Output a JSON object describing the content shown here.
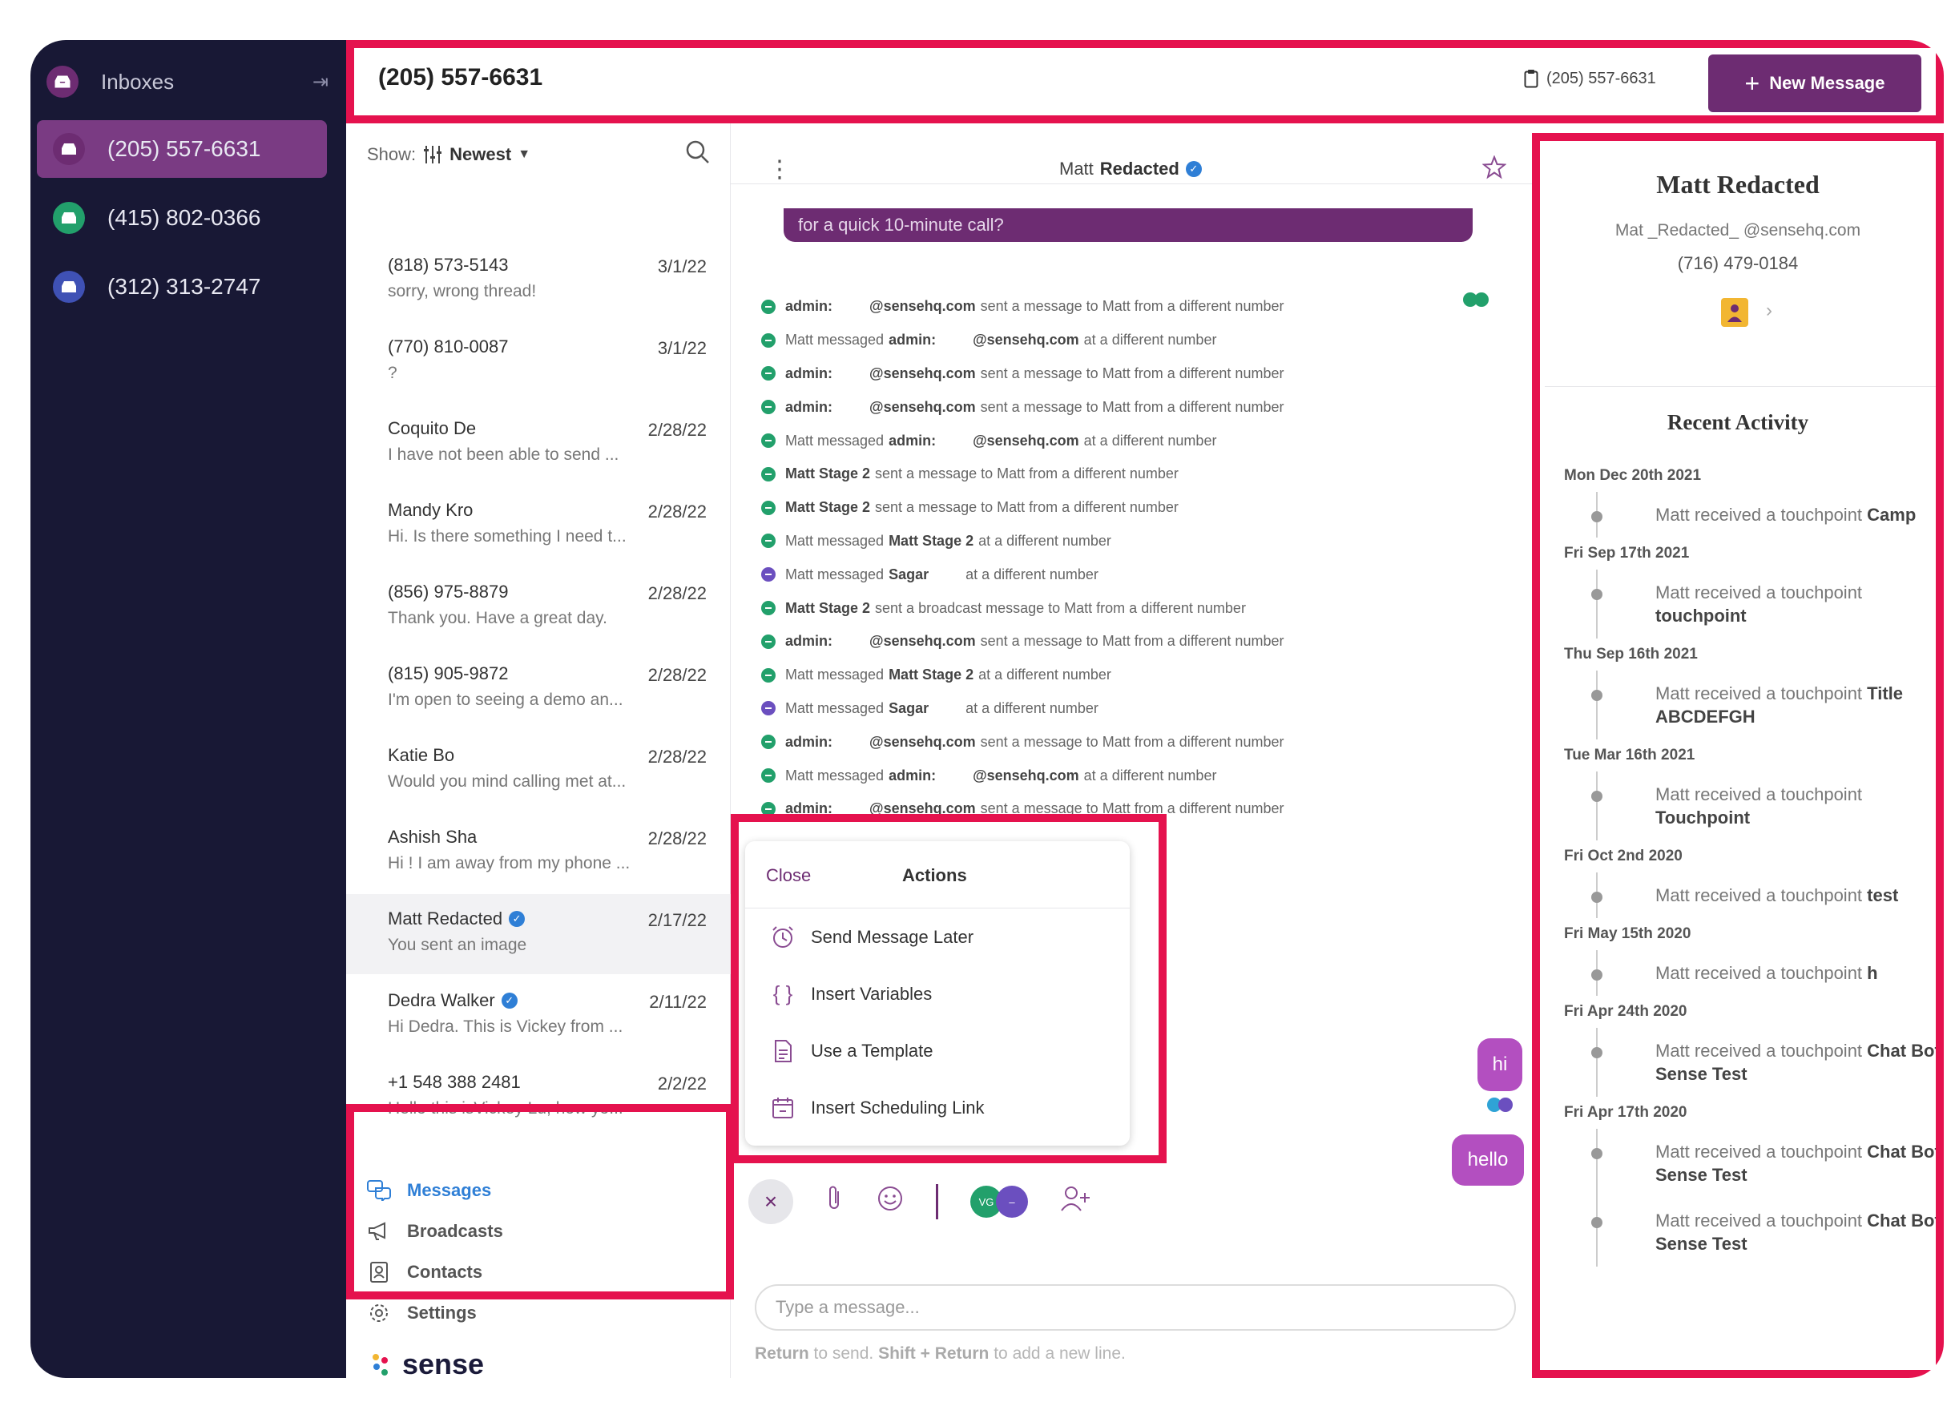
{
  "sidebar": {
    "title": "Inboxes",
    "inboxes": [
      {
        "label": "(205) 557-6631",
        "color": "#6d2c72"
      },
      {
        "label": "(415) 802-0366",
        "color": "#22a06b"
      },
      {
        "label": "(312) 313-2747",
        "color": "#3f51b5"
      }
    ]
  },
  "topbar": {
    "number": "(205) 557-6631",
    "small_number": "(205) 557-6631",
    "new_message": "New Message"
  },
  "list": {
    "show_label": "Show:",
    "sort": "Newest",
    "conversations": [
      {
        "name": "(818) 573-5143",
        "date": "3/1/22",
        "preview": "sorry, wrong thread!"
      },
      {
        "name": "(770) 810-0087",
        "date": "3/1/22",
        "preview": "?"
      },
      {
        "name": "Coquito De",
        "date": "2/28/22",
        "preview": "I have not been able to send ..."
      },
      {
        "name": "Mandy Kro",
        "date": "2/28/22",
        "preview": "Hi. Is there something I need t..."
      },
      {
        "name": "(856) 975-8879",
        "date": "2/28/22",
        "preview": "Thank you. Have a great day."
      },
      {
        "name": "(815) 905-9872",
        "date": "2/28/22",
        "preview": "I'm open to seeing a demo an..."
      },
      {
        "name": "Katie Bo",
        "date": "2/28/22",
        "preview": "Would you mind calling met at..."
      },
      {
        "name": "Ashish Sha",
        "date": "2/28/22",
        "preview": "Hi ! I am away from my phone ..."
      },
      {
        "name": "Matt  Redacted",
        "date": "2/17/22",
        "preview": "You sent an image"
      },
      {
        "name": "Dedra Walker",
        "date": "2/11/22",
        "preview": "Hi Dedra. This is Vickey from ..."
      },
      {
        "name": "+1 548 388 2481",
        "date": "2/2/22",
        "preview": "Hello this isVickey Lu, how yo..."
      }
    ]
  },
  "nav": {
    "messages": "Messages",
    "broadcasts": "Broadcasts",
    "contacts": "Contacts",
    "settings": "Settings"
  },
  "brand": "sense",
  "chat": {
    "first": "Matt",
    "last": "Redacted",
    "top_bubble": "for a quick 10-minute call?",
    "events": [
      {
        "a": "admin:",
        "b": "@sensehq.com",
        "t": "sent a message to Matt from a different number",
        "kind": "green"
      },
      {
        "pre": "Matt messaged",
        "a": "admin:",
        "b": "@sensehq.com",
        "t": "at a different number",
        "kind": "green"
      },
      {
        "a": "admin:",
        "b": "@sensehq.com",
        "t": "sent a message to Matt from a different number",
        "kind": "green"
      },
      {
        "a": "admin:",
        "b": "@sensehq.com",
        "t": "sent a message to Matt from a different number",
        "kind": "green"
      },
      {
        "pre": "Matt messaged",
        "a": "admin:",
        "b": "@sensehq.com",
        "t": "at a different number",
        "kind": "green"
      },
      {
        "a": "Matt Stage 2",
        "t": "sent a message to Matt from a different number",
        "kind": "green"
      },
      {
        "a": "Matt Stage 2",
        "t": "sent a message to Matt from a different number",
        "kind": "green"
      },
      {
        "pre": "Matt messaged",
        "a": "Matt Stage 2",
        "t": "at a different number",
        "kind": "green"
      },
      {
        "pre": "Matt messaged",
        "a": "Sagar",
        "t": "at a different number",
        "kind": "purple"
      },
      {
        "a": "Matt Stage 2",
        "t": "sent a broadcast message to Matt from a different number",
        "kind": "green"
      },
      {
        "a": "admin:",
        "b": "@sensehq.com",
        "t": "sent a message to Matt from a different number",
        "kind": "green"
      },
      {
        "pre": "Matt messaged",
        "a": "Matt Stage 2",
        "t": "at a different number",
        "kind": "green"
      },
      {
        "pre": "Matt messaged",
        "a": "Sagar",
        "t": "at a different number",
        "kind": "purple"
      },
      {
        "a": "admin:",
        "b": "@sensehq.com",
        "t": "sent a message to Matt from a different number",
        "kind": "green"
      },
      {
        "pre": "Matt messaged",
        "a": "admin:",
        "b": "@sensehq.com",
        "t": "at a different number",
        "kind": "green"
      },
      {
        "a": "admin:",
        "b": "@sensehq.com",
        "t": "sent a message to Matt from a different number",
        "kind": "green"
      }
    ],
    "msg_hi": "hi",
    "msg_hello": "hello",
    "actions": {
      "close": "Close",
      "title": "Actions",
      "items": [
        "Send Message Later",
        "Insert Variables",
        "Use a Template",
        "Insert Scheduling Link"
      ]
    },
    "avatar_initials": "VG",
    "input_placeholder": "Type a message...",
    "hint": {
      "k1": "Return",
      "t1": "to send.",
      "k2": "Shift",
      "plus": "+",
      "k3": "Return",
      "t2": "to add a new line."
    }
  },
  "profile": {
    "name": "Matt  Redacted",
    "email": "Mat _Redacted_ @sensehq.com",
    "phone": "(716) 479-0184",
    "recent_title": "Recent Activity",
    "activity": [
      {
        "date": "Mon Dec 20th 2021",
        "text": "Matt received a touchpoint",
        "bold": "Camp"
      },
      {
        "date": "Fri Sep 17th 2021",
        "text": "Matt received a touchpoint",
        "bold": "touchpoint"
      },
      {
        "date": "Thu Sep 16th 2021",
        "text": "Matt received a touchpoint",
        "bold": "Title ABCDEFGH"
      },
      {
        "date": "Tue Mar 16th 2021",
        "text": "Matt received a touchpoint",
        "bold": "Touchpoint"
      },
      {
        "date": "Fri Oct 2nd 2020",
        "text": "Matt received a touchpoint",
        "bold": "test"
      },
      {
        "date": "Fri May 15th 2020",
        "text": "Matt received a touchpoint",
        "bold": "h"
      },
      {
        "date": "Fri Apr 24th 2020",
        "text": "Matt received a touchpoint",
        "bold": "Chat Bot Sense Test"
      },
      {
        "date": "Fri Apr 17th 2020",
        "text": "Matt received a touchpoint",
        "bold": "Chat Bot Sense Test"
      },
      {
        "date": "",
        "text": "Matt received a touchpoint",
        "bold": "Chat Bot Sense Test"
      }
    ]
  },
  "colors": {
    "accent": "#6d2c72",
    "highlight": "#e5124e",
    "sidebar": "#181835",
    "link": "#2f7fd6"
  }
}
